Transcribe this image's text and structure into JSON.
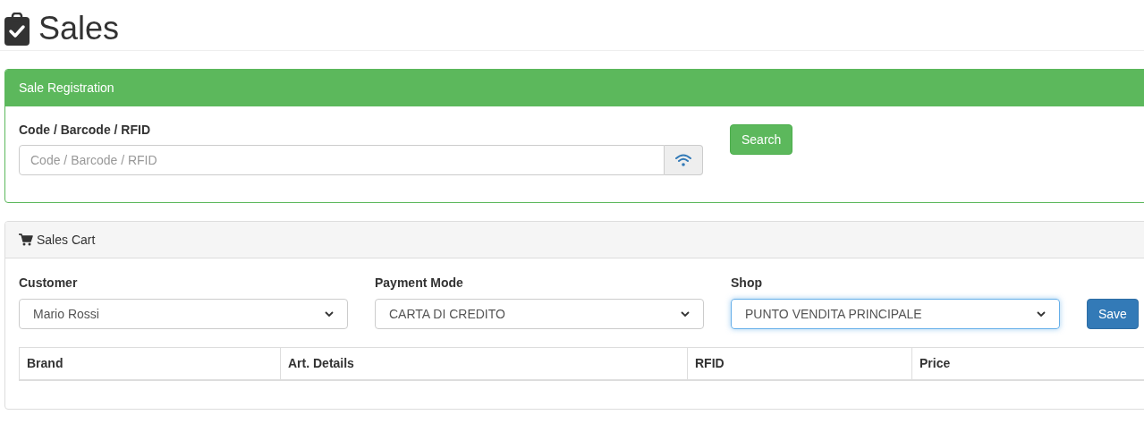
{
  "page_title": "Sales",
  "registration": {
    "title": "Sale Registration",
    "code_label": "Code / Barcode / RFID",
    "code_field": {
      "placeholder": "Code / Barcode / RFID"
    },
    "search_button": "Search"
  },
  "cart": {
    "title": "Sales Cart",
    "selects": [
      {
        "label": "Customer",
        "value": "Mario Rossi",
        "focused": false
      },
      {
        "label": "Payment Mode",
        "value": "CARTA DI CREDITO",
        "focused": false
      },
      {
        "label": "Shop",
        "value": "PUNTO VENDITA PRINCIPALE",
        "focused": true
      }
    ],
    "save_button": "Save",
    "table": {
      "columns": [
        "Brand",
        "Art. Details",
        "RFID",
        "Price"
      ]
    }
  }
}
